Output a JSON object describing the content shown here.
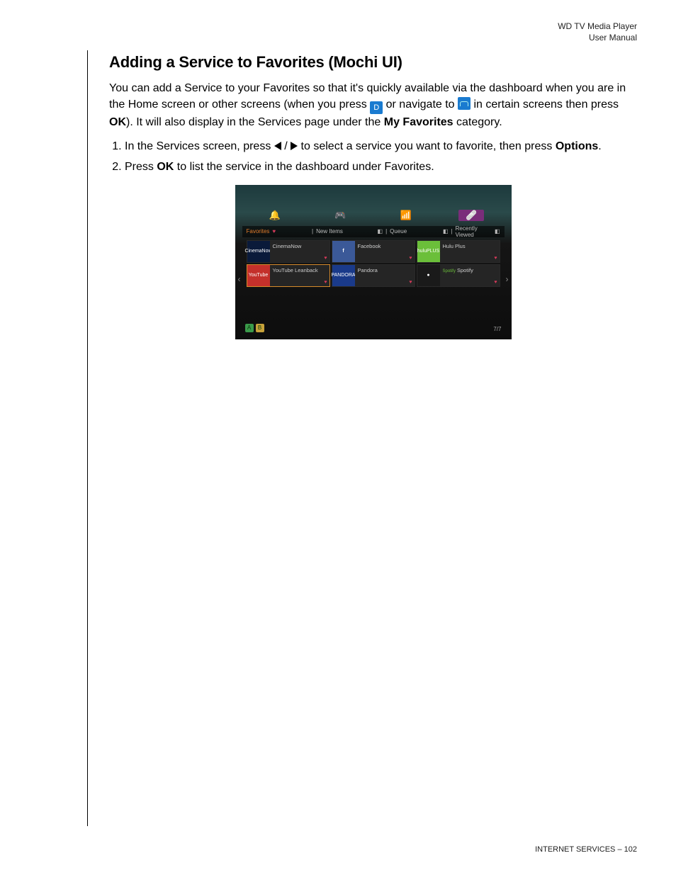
{
  "header": {
    "line1": "WD TV Media Player",
    "line2": "User Manual"
  },
  "title": "Adding a Service to Favorites (Mochi UI)",
  "intro": {
    "part1": "You can add a Service to your Favorites so that it's quickly available via the dashboard when you are in the Home screen or other screens (when you press ",
    "part2": " or navigate to ",
    "part3": " in certain screens then press ",
    "ok1": "OK",
    "part4": "). It will also display in the Services page under the ",
    "myfav": "My Favorites",
    "part5": " category."
  },
  "steps": {
    "s1a": "In the Services screen, press ",
    "s1b": " to select a service you want to favorite, then press ",
    "s1opt": "Options",
    "s1c": ".",
    "s2a": "Press ",
    "s2ok": "OK",
    "s2b": " to list the service in the dashboard under Favorites."
  },
  "screenshot": {
    "tabs": {
      "favorites": "Favorites",
      "newitems": "New Items",
      "queue": "Queue",
      "recent": "Recently Viewed"
    },
    "tiles": {
      "cinemanow": "CinemaNow",
      "facebook": "Facebook",
      "huluplus": "Hulu Plus",
      "youtube": "YouTube Leanback",
      "pandora": "Pandora",
      "spotify": "Spotify"
    },
    "thumbs": {
      "cinemanow": "CinemaNow",
      "facebook": "f",
      "hulu": "huluPLUS",
      "youtube": "YouTube",
      "pandora": "PANDORA",
      "spotify": "Spotify"
    },
    "counter": "7/7"
  },
  "footer": {
    "section": "INTERNET SERVICES",
    "sep": " – ",
    "page": "102"
  }
}
